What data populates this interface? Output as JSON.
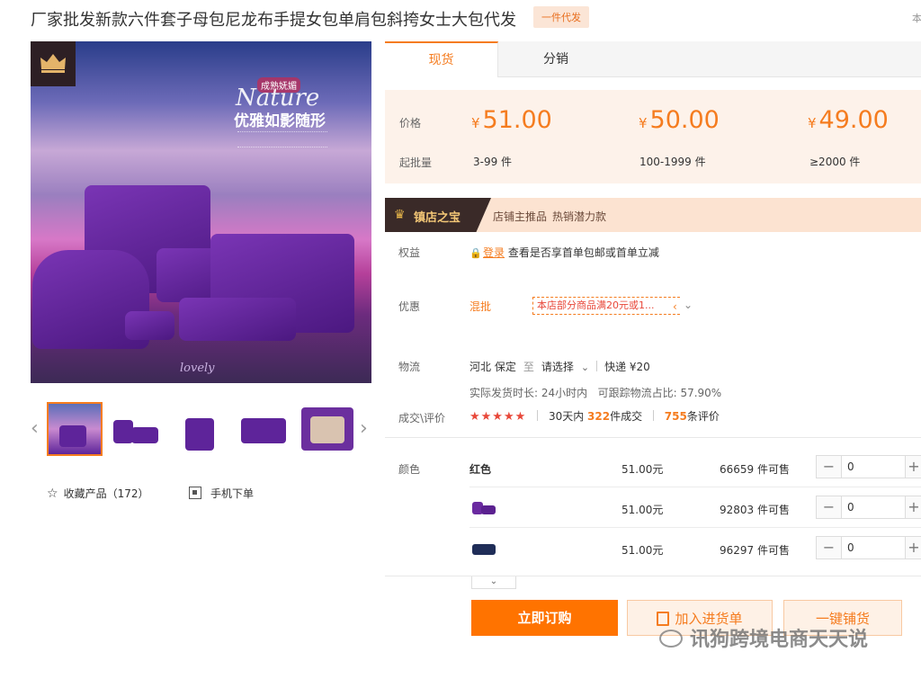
{
  "product": {
    "title": "厂家批发新款六件套子母包尼龙布手提女包单肩包斜挎女士大包代发",
    "tag": "一件代发",
    "clipped_right_char": "本"
  },
  "image_text": {
    "script": "Nature",
    "cn_top": "成熟妩媚",
    "cn_main": "优雅如影随形",
    "lovely": "lovely"
  },
  "favorite": {
    "label": "收藏产品（172）"
  },
  "mobile_order": {
    "label": "手机下单"
  },
  "tabs": [
    {
      "label": "现货",
      "active": true
    },
    {
      "label": "分销",
      "active": false
    }
  ],
  "pricing": {
    "price_label": "价格",
    "moq_label": "起批量",
    "currency_symbol": "¥",
    "tiers": [
      {
        "price": "51.00",
        "range": "3-99 件"
      },
      {
        "price": "50.00",
        "range": "100-1999 件"
      },
      {
        "price": "49.00",
        "range": "≥2000 件"
      }
    ]
  },
  "shop_banner": {
    "badge": "镇店之宝",
    "tags": [
      "店铺主推品",
      "热销潜力款"
    ]
  },
  "benefits": {
    "label": "权益",
    "login": "登录",
    "text": "查看是否享首单包邮或首单立减"
  },
  "promo": {
    "label": "优惠",
    "tag": "混批",
    "text": "本店部分商品满20元或1..."
  },
  "logistics": {
    "label": "物流",
    "origin": "河北 保定",
    "to": "至",
    "dest": "请选择",
    "express": "快递 ¥20",
    "ship_time": "实际发货时长: 24小时内",
    "trace_ratio": "可跟踪物流占比: 57.90%"
  },
  "reviews": {
    "label": "成交\\评价",
    "stars": "★★★★★",
    "deals_prefix": "30天内",
    "deals_count": "322",
    "deals_suffix": "件成交",
    "reviews_count": "755",
    "reviews_suffix": "条评价"
  },
  "sku": {
    "label": "颜色",
    "rows": [
      {
        "name": "红色",
        "price": "51.00元",
        "stock": "66659 件可售",
        "qty": "0"
      },
      {
        "name": "",
        "price": "51.00元",
        "stock": "92803 件可售",
        "qty": "0"
      },
      {
        "name": "",
        "price": "51.00元",
        "stock": "96297 件可售",
        "qty": "0"
      }
    ]
  },
  "actions": {
    "order": "立即订购",
    "add": "加入进货单",
    "list": "一键铺货"
  },
  "watermark": "讯狗跨境电商天天说",
  "colors": {
    "accent": "#f57c1f",
    "order_button": "#ff7300",
    "price_bg": "#fdf2ea",
    "star": "#e8483a"
  }
}
